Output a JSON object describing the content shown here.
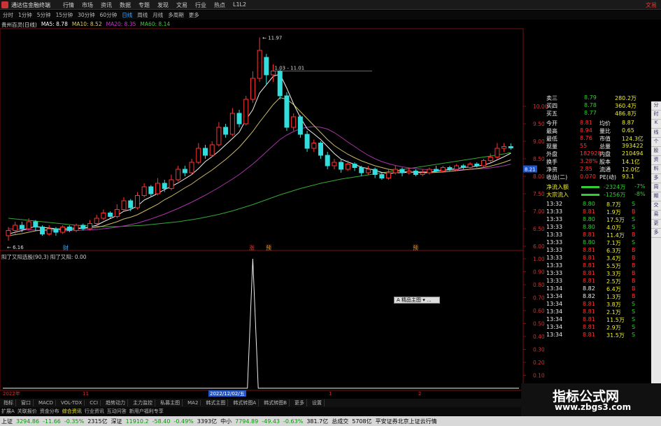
{
  "window": {
    "title": "通达信金融终端",
    "menu": [
      "行情",
      "市场",
      "资讯",
      "数据",
      "专题",
      "发现",
      "文易",
      "行业",
      "热点",
      "L1L2"
    ],
    "right_label": "文易"
  },
  "toolbar": [
    "分时",
    "1分钟",
    "5分钟",
    "15分钟",
    "30分钟",
    "60分钟",
    "日线",
    "周线",
    "月线",
    "多周期",
    "更多"
  ],
  "toolbar_active": "日线",
  "ma_legend": {
    "stock": "贵州百灵(日线)",
    "items": [
      {
        "label": "MA5: 8.78",
        "color": "#ffffff"
      },
      {
        "label": "MA10: 8.52",
        "color": "#ddcc66"
      },
      {
        "label": "MA20: 8.35",
        "color": "#cc33cc"
      },
      {
        "label": "MA60: 8.14",
        "color": "#33cc33"
      }
    ]
  },
  "annotations": {
    "high_label": "11.97",
    "range_label": "1.03 - 11.01",
    "low_label": "6.16",
    "markers": [
      "财",
      "涨",
      "预",
      "预"
    ],
    "price_tag": "8.21",
    "date_tag": "2022/12/02/五",
    "axis_start": "2022年",
    "axis_m11": "11",
    "axis_m1": "1",
    "axis_m2": "2"
  },
  "indicator": {
    "legend": "阳了又阳选股(90,3)  阳了又阳: 0.00",
    "popup": "A 精品主图 ▾ ..."
  },
  "chart_data": [
    {
      "type": "candlestick",
      "title": "",
      "y_ticks": [
        10.0,
        9.5,
        9.0,
        8.5,
        8.0,
        7.5,
        7.0,
        6.5,
        6.0
      ],
      "ylim": [
        6.0,
        12.2
      ],
      "bars": [
        {
          "o": 6.3,
          "c": 6.45,
          "h": 6.55,
          "l": 6.16
        },
        {
          "o": 6.45,
          "c": 6.6,
          "h": 6.7,
          "l": 6.35
        },
        {
          "o": 6.6,
          "c": 6.5,
          "h": 6.7,
          "l": 6.4
        },
        {
          "o": 6.5,
          "c": 6.7,
          "h": 6.8,
          "l": 6.45
        },
        {
          "o": 6.7,
          "c": 6.55,
          "h": 6.75,
          "l": 6.45
        },
        {
          "o": 6.55,
          "c": 6.35,
          "h": 6.6,
          "l": 6.3
        },
        {
          "o": 6.35,
          "c": 6.5,
          "h": 6.6,
          "l": 6.3
        },
        {
          "o": 6.5,
          "c": 6.4,
          "h": 6.55,
          "l": 6.3
        },
        {
          "o": 6.4,
          "c": 6.55,
          "h": 6.6,
          "l": 6.35
        },
        {
          "o": 6.55,
          "c": 6.45,
          "h": 6.6,
          "l": 6.4
        },
        {
          "o": 6.45,
          "c": 6.6,
          "h": 6.65,
          "l": 6.4
        },
        {
          "o": 6.6,
          "c": 6.5,
          "h": 6.65,
          "l": 6.45
        },
        {
          "o": 6.5,
          "c": 6.65,
          "h": 6.75,
          "l": 6.45
        },
        {
          "o": 6.65,
          "c": 6.8,
          "h": 6.9,
          "l": 6.6
        },
        {
          "o": 6.8,
          "c": 6.95,
          "h": 7.05,
          "l": 6.75
        },
        {
          "o": 6.95,
          "c": 6.85,
          "h": 7.0,
          "l": 6.8
        },
        {
          "o": 6.85,
          "c": 7.05,
          "h": 7.2,
          "l": 6.8
        },
        {
          "o": 7.05,
          "c": 7.3,
          "h": 7.4,
          "l": 7.0
        },
        {
          "o": 7.3,
          "c": 7.1,
          "h": 7.35,
          "l": 7.0
        },
        {
          "o": 7.1,
          "c": 7.45,
          "h": 7.55,
          "l": 7.05
        },
        {
          "o": 7.45,
          "c": 7.7,
          "h": 7.8,
          "l": 7.4
        },
        {
          "o": 7.7,
          "c": 7.5,
          "h": 7.75,
          "l": 7.4
        },
        {
          "o": 7.5,
          "c": 7.8,
          "h": 7.95,
          "l": 7.45
        },
        {
          "o": 7.8,
          "c": 7.65,
          "h": 7.9,
          "l": 7.55
        },
        {
          "o": 7.65,
          "c": 7.9,
          "h": 8.05,
          "l": 7.6
        },
        {
          "o": 7.9,
          "c": 8.2,
          "h": 8.3,
          "l": 7.85
        },
        {
          "o": 8.2,
          "c": 8.1,
          "h": 8.3,
          "l": 8.0
        },
        {
          "o": 8.1,
          "c": 8.4,
          "h": 8.5,
          "l": 8.05
        },
        {
          "o": 8.4,
          "c": 8.8,
          "h": 8.95,
          "l": 8.35
        },
        {
          "o": 8.8,
          "c": 8.6,
          "h": 8.9,
          "l": 8.5
        },
        {
          "o": 8.6,
          "c": 8.9,
          "h": 9.0,
          "l": 8.55
        },
        {
          "o": 8.9,
          "c": 9.4,
          "h": 9.55,
          "l": 8.85
        },
        {
          "o": 9.4,
          "c": 9.2,
          "h": 9.5,
          "l": 9.1
        },
        {
          "o": 9.2,
          "c": 9.8,
          "h": 9.95,
          "l": 9.15
        },
        {
          "o": 9.8,
          "c": 9.5,
          "h": 9.9,
          "l": 9.4
        },
        {
          "o": 9.5,
          "c": 10.2,
          "h": 10.3,
          "l": 9.45
        },
        {
          "o": 10.2,
          "c": 10.8,
          "h": 11.0,
          "l": 10.1
        },
        {
          "o": 10.8,
          "c": 11.6,
          "h": 11.97,
          "l": 10.7
        },
        {
          "o": 11.4,
          "c": 10.9,
          "h": 11.5,
          "l": 10.6
        },
        {
          "o": 10.9,
          "c": 11.01,
          "h": 11.2,
          "l": 10.7
        },
        {
          "o": 11.01,
          "c": 10.3,
          "h": 11.05,
          "l": 10.2
        },
        {
          "o": 10.3,
          "c": 9.4,
          "h": 10.4,
          "l": 9.3
        },
        {
          "o": 9.4,
          "c": 9.7,
          "h": 9.8,
          "l": 9.3
        },
        {
          "o": 9.7,
          "c": 9.2,
          "h": 9.75,
          "l": 9.1
        },
        {
          "o": 9.2,
          "c": 8.8,
          "h": 9.3,
          "l": 8.7
        },
        {
          "o": 8.8,
          "c": 8.95,
          "h": 9.05,
          "l": 8.7
        },
        {
          "o": 8.95,
          "c": 8.6,
          "h": 9.0,
          "l": 8.5
        },
        {
          "o": 8.6,
          "c": 8.3,
          "h": 8.7,
          "l": 8.2
        },
        {
          "o": 8.3,
          "c": 8.4,
          "h": 8.5,
          "l": 8.2
        },
        {
          "o": 8.4,
          "c": 8.2,
          "h": 8.5,
          "l": 8.1
        },
        {
          "o": 8.2,
          "c": 8.35,
          "h": 8.45,
          "l": 8.15
        },
        {
          "o": 8.35,
          "c": 8.25,
          "h": 8.4,
          "l": 8.15
        },
        {
          "o": 8.25,
          "c": 8.1,
          "h": 8.3,
          "l": 8.0
        },
        {
          "o": 8.1,
          "c": 8.2,
          "h": 8.3,
          "l": 8.05
        },
        {
          "o": 8.2,
          "c": 8.05,
          "h": 8.25,
          "l": 7.95
        },
        {
          "o": 8.05,
          "c": 7.95,
          "h": 8.1,
          "l": 7.9
        },
        {
          "o": 7.95,
          "c": 8.1,
          "h": 8.2,
          "l": 7.9
        },
        {
          "o": 8.1,
          "c": 8.2,
          "h": 8.3,
          "l": 8.05
        },
        {
          "o": 8.2,
          "c": 8.1,
          "h": 8.25,
          "l": 8.0
        },
        {
          "o": 8.1,
          "c": 8.15,
          "h": 8.25,
          "l": 8.05
        },
        {
          "o": 8.15,
          "c": 8.05,
          "h": 8.2,
          "l": 8.0
        },
        {
          "o": 8.05,
          "c": 8.1,
          "h": 8.2,
          "l": 8.0
        },
        {
          "o": 8.1,
          "c": 8.2,
          "h": 8.25,
          "l": 8.05
        },
        {
          "o": 8.2,
          "c": 8.15,
          "h": 8.3,
          "l": 8.1
        },
        {
          "o": 8.15,
          "c": 8.25,
          "h": 8.3,
          "l": 8.1
        },
        {
          "o": 8.25,
          "c": 8.2,
          "h": 8.3,
          "l": 8.15
        },
        {
          "o": 8.2,
          "c": 8.3,
          "h": 8.35,
          "l": 8.15
        },
        {
          "o": 8.3,
          "c": 8.25,
          "h": 8.35,
          "l": 8.2
        },
        {
          "o": 8.25,
          "c": 8.35,
          "h": 8.4,
          "l": 8.2
        },
        {
          "o": 8.35,
          "c": 8.3,
          "h": 8.4,
          "l": 8.25
        },
        {
          "o": 8.3,
          "c": 8.45,
          "h": 8.5,
          "l": 8.25
        },
        {
          "o": 8.45,
          "c": 8.55,
          "h": 8.65,
          "l": 8.4
        },
        {
          "o": 8.55,
          "c": 8.8,
          "h": 8.95,
          "l": 8.5
        },
        {
          "o": 8.8,
          "c": 8.85,
          "h": 8.95,
          "l": 8.7
        },
        {
          "o": 8.85,
          "c": 8.81,
          "h": 8.94,
          "l": 8.76
        }
      ],
      "ma5": [
        6.35,
        6.4,
        6.45,
        6.52,
        6.56,
        6.54,
        6.52,
        6.5,
        6.47,
        6.47,
        6.5,
        6.52,
        6.55,
        6.6,
        6.7,
        6.79,
        6.88,
        7.0,
        7.05,
        7.15,
        7.32,
        7.41,
        7.51,
        7.62,
        7.71,
        7.81,
        7.93,
        8.05,
        8.22,
        8.42,
        8.56,
        8.72,
        8.9,
        9.08,
        9.26,
        9.62,
        9.9,
        10.38,
        10.62,
        10.86,
        10.92,
        10.52,
        10.07,
        9.68,
        9.36,
        9.21,
        9.05,
        8.85,
        8.65,
        8.49,
        8.41,
        8.34,
        8.26,
        8.22,
        8.17,
        8.11,
        8.08,
        8.1,
        8.1,
        8.12,
        8.12,
        8.12,
        8.12,
        8.14,
        8.17,
        8.19,
        8.22,
        8.25,
        8.27,
        8.29,
        8.32,
        8.38,
        8.47,
        8.56,
        8.66
      ],
      "ma10": [
        6.3,
        6.33,
        6.36,
        6.4,
        6.44,
        6.46,
        6.47,
        6.49,
        6.5,
        6.52,
        6.52,
        6.52,
        6.52,
        6.54,
        6.58,
        6.64,
        6.7,
        6.78,
        6.83,
        6.9,
        7.0,
        7.1,
        7.2,
        7.33,
        7.43,
        7.55,
        7.67,
        7.78,
        7.92,
        8.05,
        8.18,
        8.33,
        8.48,
        8.65,
        8.83,
        9.05,
        9.28,
        9.55,
        9.8,
        10.05,
        10.25,
        10.2,
        10.05,
        9.85,
        9.65,
        9.45,
        9.25,
        9.05,
        8.88,
        8.75,
        8.63,
        8.53,
        8.44,
        8.37,
        8.3,
        8.25,
        8.2,
        8.17,
        8.14,
        8.12,
        8.11,
        8.1,
        8.1,
        8.11,
        8.12,
        8.14,
        8.16,
        8.18,
        8.2,
        8.22,
        8.25,
        8.29,
        8.34,
        8.4,
        8.47
      ],
      "ma20": [
        6.5,
        6.49,
        6.48,
        6.47,
        6.46,
        6.45,
        6.44,
        6.44,
        6.44,
        6.44,
        6.45,
        6.46,
        6.47,
        6.48,
        6.5,
        6.52,
        6.55,
        6.58,
        6.62,
        6.66,
        6.72,
        6.78,
        6.85,
        6.92,
        7.0,
        7.08,
        7.17,
        7.26,
        7.36,
        7.46,
        7.57,
        7.68,
        7.8,
        7.92,
        8.05,
        8.2,
        8.35,
        8.52,
        8.7,
        8.88,
        9.05,
        9.18,
        9.28,
        9.36,
        9.4,
        9.42,
        9.4,
        9.35,
        9.25,
        9.12,
        8.98,
        8.85,
        8.72,
        8.6,
        8.5,
        8.42,
        8.36,
        8.31,
        8.27,
        8.24,
        8.22,
        8.2,
        8.19,
        8.18,
        8.18,
        8.18,
        8.18,
        8.19,
        8.2,
        8.21,
        8.22,
        8.24,
        8.27,
        8.3,
        8.35
      ],
      "ma60": [
        6.8,
        6.78,
        6.76,
        6.74,
        6.72,
        6.7,
        6.68,
        6.66,
        6.64,
        6.62,
        6.6,
        6.59,
        6.58,
        6.57,
        6.56,
        6.56,
        6.56,
        6.57,
        6.58,
        6.59,
        6.6,
        6.62,
        6.64,
        6.66,
        6.68,
        6.7,
        6.73,
        6.76,
        6.79,
        6.83,
        6.87,
        6.91,
        6.96,
        7.01,
        7.07,
        7.13,
        7.19,
        7.26,
        7.33,
        7.4,
        7.47,
        7.53,
        7.59,
        7.65,
        7.7,
        7.75,
        7.8,
        7.84,
        7.88,
        7.92,
        7.95,
        7.98,
        8.01,
        8.04,
        8.07,
        8.1,
        8.13,
        8.16,
        8.19,
        8.22,
        8.25,
        8.28,
        8.31,
        8.34,
        8.37,
        8.4,
        8.43,
        8.46,
        8.49,
        8.52,
        8.55,
        8.58,
        8.61,
        8.64,
        8.68
      ]
    },
    {
      "type": "line",
      "title": "阳了又阳",
      "y_ticks": [
        1.0,
        0.9,
        0.8,
        0.7,
        0.6,
        0.5,
        0.4,
        0.3,
        0.2,
        0.1,
        0.0
      ],
      "ylim": [
        0,
        1.0
      ],
      "values_note": "signal 0 everywhere except a single spike to 1.00 at bar 36",
      "spike_index": 36
    }
  ],
  "quote_panel": {
    "asks": [
      {
        "label": "卖三",
        "price": "8.79",
        "vol": "280.2万"
      },
      {
        "label": "买四",
        "price": "8.78",
        "vol": "360.4万"
      },
      {
        "label": "买五",
        "price": "8.77",
        "vol": "486.8万"
      }
    ],
    "stats": [
      {
        "l1": "今开",
        "v1": "8.81",
        "l2": "均价",
        "v2": "8.87"
      },
      {
        "l1": "最高",
        "v1": "8.94",
        "l2": "量比",
        "v2": "0.65"
      },
      {
        "l1": "最低",
        "v1": "8.76",
        "l2": "市值",
        "v2": "124.3亿"
      },
      {
        "l1": "现量",
        "v1": "55",
        "l2": "总量",
        "v2": "393422"
      },
      {
        "l1": "外盘",
        "v1": "182928",
        "l2": "内盘",
        "v2": "210494"
      },
      {
        "l1": "换手",
        "v1": "3.28%",
        "l2": "股本",
        "v2": "14.1亿"
      },
      {
        "l1": "净资",
        "v1": "2.85",
        "l2": "流通",
        "v2": "12.0亿"
      },
      {
        "l1": "收益(二)",
        "v1": "0.070",
        "l2": "PE(动)",
        "v2": "93.1"
      }
    ],
    "flows": [
      {
        "label": "净流入额",
        "value": "-2324万",
        "pct": "-7%"
      },
      {
        "label": "大宗流入",
        "value": "-1256万",
        "pct": "-8%"
      }
    ],
    "ticks": [
      {
        "t": "13:32",
        "p": "8.80",
        "v": "8.7万",
        "s": "S"
      },
      {
        "t": "13:33",
        "p": "8.81",
        "v": "1.9万",
        "s": "B"
      },
      {
        "t": "13:33",
        "p": "8.80",
        "v": "17.5万",
        "s": "S"
      },
      {
        "t": "13:33",
        "p": "8.80",
        "v": "4.0万",
        "s": "S"
      },
      {
        "t": "13:33",
        "p": "8.81",
        "v": "11.4万",
        "s": "B"
      },
      {
        "t": "13:33",
        "p": "8.80",
        "v": "7.1万",
        "s": "S"
      },
      {
        "t": "13:33",
        "p": "8.81",
        "v": "6.3万",
        "s": "B"
      },
      {
        "t": "13:33",
        "p": "8.81",
        "v": "3.4万",
        "s": "B"
      },
      {
        "t": "13:33",
        "p": "8.81",
        "v": "5.5万",
        "s": "B"
      },
      {
        "t": "13:33",
        "p": "8.81",
        "v": "3.3万",
        "s": "B"
      },
      {
        "t": "13:33",
        "p": "8.81",
        "v": "2.5万",
        "s": "B"
      },
      {
        "t": "13:34",
        "p": "8.82",
        "v": "6.4万",
        "s": "B"
      },
      {
        "t": "13:34",
        "p": "8.82",
        "v": "1.3万",
        "s": "B"
      },
      {
        "t": "13:34",
        "p": "8.81",
        "v": "3.8万",
        "s": "S"
      },
      {
        "t": "13:34",
        "p": "8.81",
        "v": "2.1万",
        "s": "S"
      },
      {
        "t": "13:34",
        "p": "8.81",
        "v": "11.5万",
        "s": "S"
      },
      {
        "t": "13:34",
        "p": "8.81",
        "v": "2.9万",
        "s": "S"
      },
      {
        "t": "13:34",
        "p": "8.81",
        "v": "31.5万",
        "s": "S"
      }
    ]
  },
  "side_toolbar": [
    "分",
    "时",
    "K",
    "线",
    "个",
    "股",
    "资",
    "料",
    "多",
    "周",
    "期",
    "交",
    "易",
    "更",
    "多"
  ],
  "tabs_row1": [
    "指标",
    "窗口",
    "MACD",
    "VOL-TDX",
    "CCI",
    "趋势动力",
    "主力监控",
    "私募主图",
    "MA2",
    "韩式主图",
    "韩式转图A",
    "韩式转图B",
    "更多",
    "设置"
  ],
  "tabs_row2": [
    "扩展A",
    "关联报价",
    "资金分布",
    "综合资讯",
    "行业资讯",
    "互动问答",
    "新用户福利专享"
  ],
  "tabs_row2_highlight": [
    "综合资讯"
  ],
  "status": {
    "items": [
      {
        "name": "上证",
        "value": "3294.86",
        "chg": "-11.66",
        "pct": "-0.35%",
        "amt": "2315亿"
      },
      {
        "name": "深证",
        "value": "11910.2",
        "chg": "-58.40",
        "pct": "-0.49%",
        "amt": "3393亿"
      },
      {
        "name": "中小",
        "value": "7794.89",
        "chg": "-49.43",
        "pct": "-0.63%",
        "amt": "381.7亿"
      }
    ],
    "total_label": "总成交",
    "total_value": "5708亿",
    "broker": "平安证券北京上证云行情"
  },
  "watermark": {
    "line1": "指标公式网",
    "line2": "www.zbgs3.com"
  }
}
